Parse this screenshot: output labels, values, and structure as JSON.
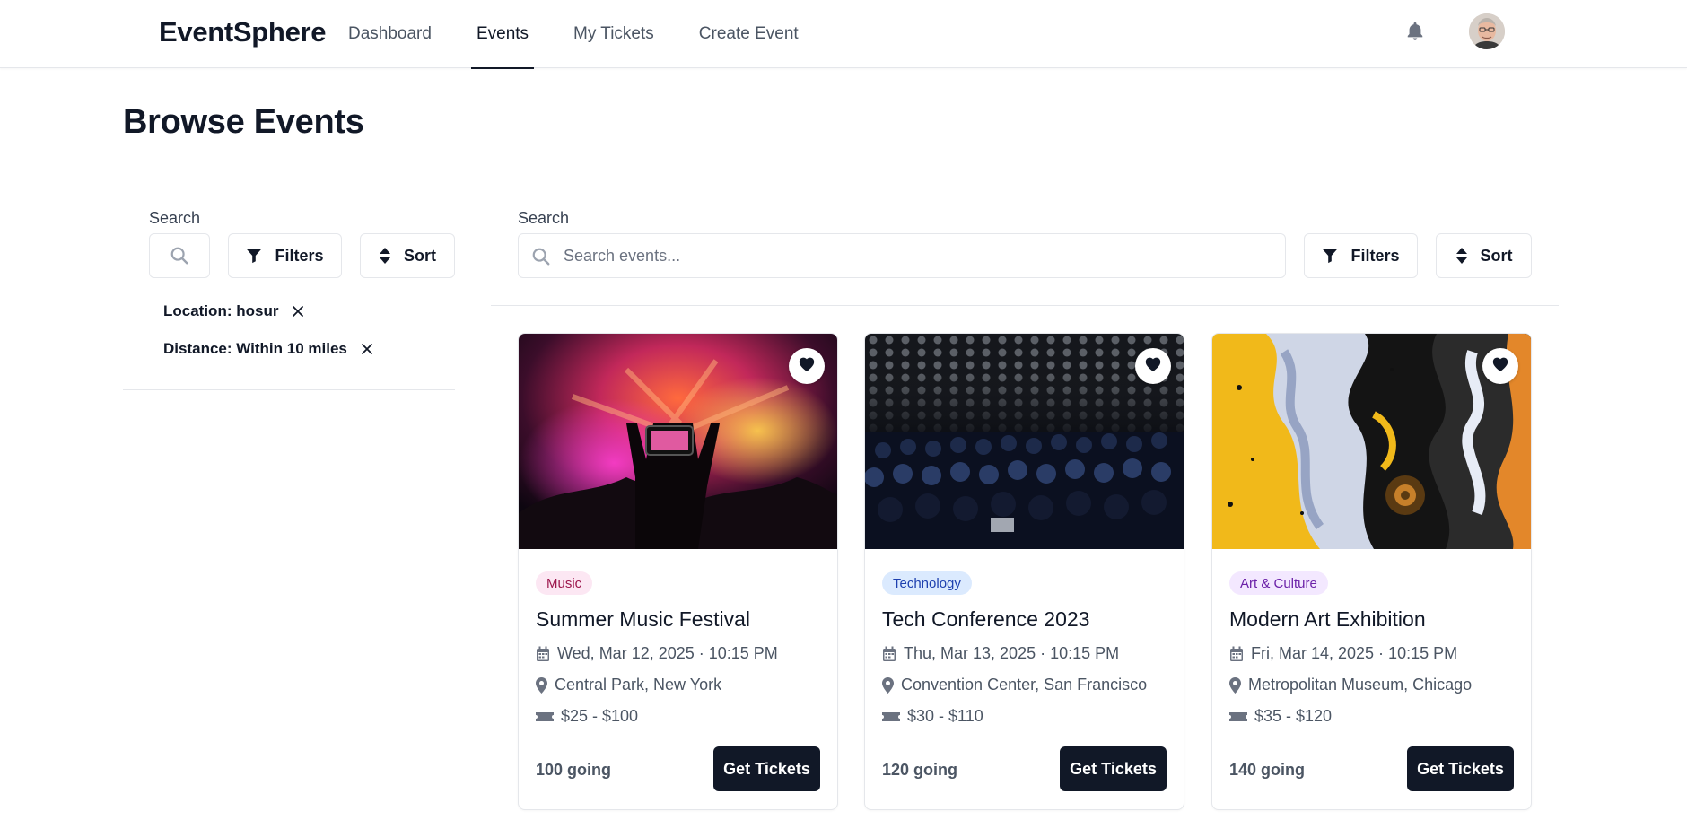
{
  "header": {
    "brand": "EventSphere",
    "nav": [
      "Dashboard",
      "Events",
      "My Tickets",
      "Create Event"
    ],
    "active_nav": "Events"
  },
  "page": {
    "title": "Browse Events"
  },
  "sidebar": {
    "search_label": "Search",
    "filters_label": "Filters",
    "sort_label": "Sort",
    "active_filters": [
      "Location: hosur",
      "Distance: Within 10 miles"
    ]
  },
  "main": {
    "search_label": "Search",
    "search_placeholder": "Search events...",
    "filters_label": "Filters",
    "sort_label": "Sort"
  },
  "events": [
    {
      "category": "Music",
      "title": "Summer Music Festival",
      "date": "Wed, Mar 12, 2025 · 10:15 PM",
      "location": "Central Park, New York",
      "price": "$25 - $100",
      "going": "100 going",
      "cta": "Get Tickets"
    },
    {
      "category": "Technology",
      "title": "Tech Conference 2023",
      "date": "Thu, Mar 13, 2025 · 10:15 PM",
      "location": "Convention Center, San Francisco",
      "price": "$30 - $110",
      "going": "120 going",
      "cta": "Get Tickets"
    },
    {
      "category": "Art & Culture",
      "title": "Modern Art Exhibition",
      "date": "Fri, Mar 14, 2025 · 10:15 PM",
      "location": "Metropolitan Museum, Chicago",
      "price": "$35 - $120",
      "going": "140 going",
      "cta": "Get Tickets"
    }
  ],
  "colors": {
    "primary": "#111827",
    "music_badge_bg": "#fce7f3",
    "music_badge_text": "#9d174d",
    "tech_badge_bg": "#dbeafe",
    "tech_badge_text": "#1e40af",
    "art_badge_bg": "#f3e8ff",
    "art_badge_text": "#6b21a8"
  },
  "icons": [
    "bell-icon",
    "avatar",
    "search-icon",
    "filter-icon",
    "sort-icon",
    "close-icon",
    "heart-icon",
    "calendar-icon",
    "map-pin-icon",
    "ticket-icon"
  ]
}
